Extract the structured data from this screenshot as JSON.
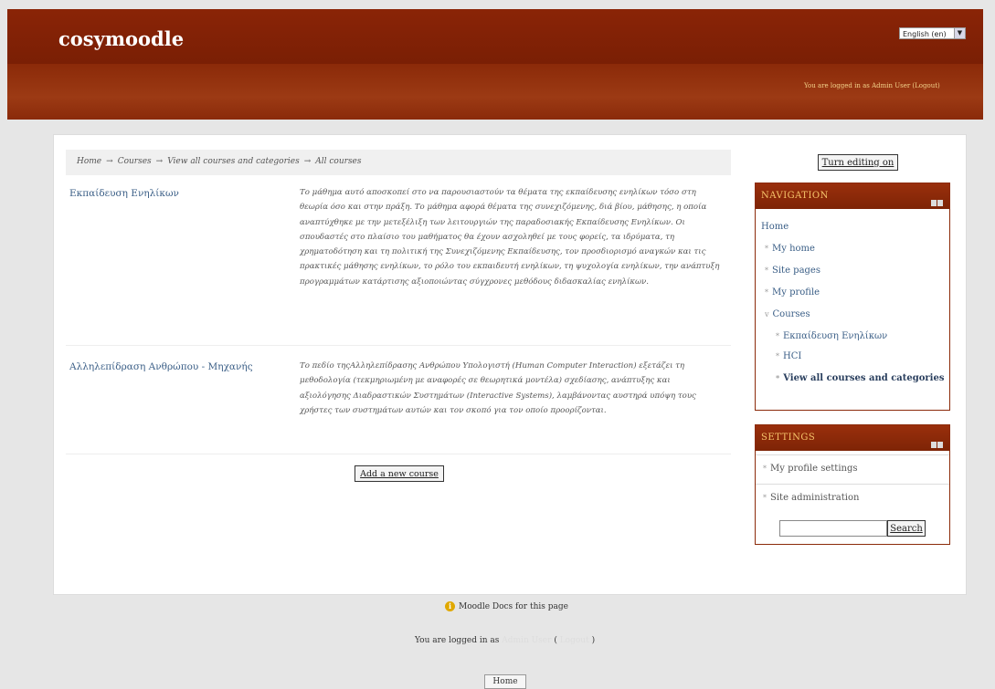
{
  "header": {
    "site_title": "cosymoodle",
    "language": "English (en)",
    "login_info": "You are logged in as Admin User (Logout)"
  },
  "breadcrumb": {
    "items": [
      "Home",
      "Courses",
      "View all courses and categories",
      "All courses"
    ],
    "separator": "→"
  },
  "courses": [
    {
      "name": "Εκπαίδευση Ενηλίκων",
      "summary": "Το μάθημα αυτό αποσκοπεί στο να παρουσιαστούν τα θέματα της εκπαίδευσης ενηλίκων τόσο στη θεωρία όσο και στην πράξη. Το μάθημα αφορά θέματα της συνεχιζόμενης, διά βίου, μάθησης, η οποία αναπτύχθηκε με την μετεξέλιξη των λειτουργιών της παραδοσιακής Εκπαίδευσης Ενηλίκων. Οι σπουδαστές στο πλαίσιο του μαθήματος θα έχουν ασχοληθεί με τους φορείς, τα ιδρύματα, τη χρηματοδότηση και τη πολιτική της Συνεχιζόμενης Εκπαίδευσης, τον προσδιορισμό αναγκών και τις πρακτικές μάθησης ενηλίκων, το ρόλο του εκπαιδευτή ενηλίκων, τη ψυχολογία ενηλίκων, την ανάπτυξη προγραμμάτων κατάρτισης αξιοποιώντας σύγχρονες μεθόδους διδασκαλίας ενηλίκων."
    },
    {
      "name": "Αλληλεπίδραση Ανθρώπου - Μηχανής",
      "summary": "Το πεδίο τηςΑλληλεπίδρασης Ανθρώπου Υπολογιστή (Human Computer Interaction) εξετάζει τη μεθοδολογία (τεκμηριωμένη με αναφορές σε θεωρητικά μοντέλα) σχεδίασης, ανάπτυξης και αξιολόγησης Διαδραστικών Συστημάτων (Interactive Systems), λαμβάνοντας αυστηρά υπόψη τους χρήστες των συστημάτων αυτών και τον σκοπό για τον οποίο προορίζονται."
    }
  ],
  "buttons": {
    "add_course": "Add a new course",
    "turn_editing": "Turn editing on",
    "search": "Search",
    "home": "Home"
  },
  "navigation": {
    "title": "NAVIGATION",
    "home": "Home",
    "items": [
      "My home",
      "Site pages",
      "My profile",
      "Courses"
    ],
    "courses_sub": [
      "Εκπαίδευση Ενηλίκων",
      "HCI",
      "View all courses and categories"
    ]
  },
  "settings": {
    "title": "SETTINGS",
    "items": [
      "My profile settings",
      "Site administration"
    ]
  },
  "footer": {
    "docs_link": "Moodle Docs for this page",
    "login_prefix": "You are logged in as",
    "login_user": "Admin User",
    "logout": "Logout",
    "open_paren": "(",
    "close_paren": ")"
  }
}
